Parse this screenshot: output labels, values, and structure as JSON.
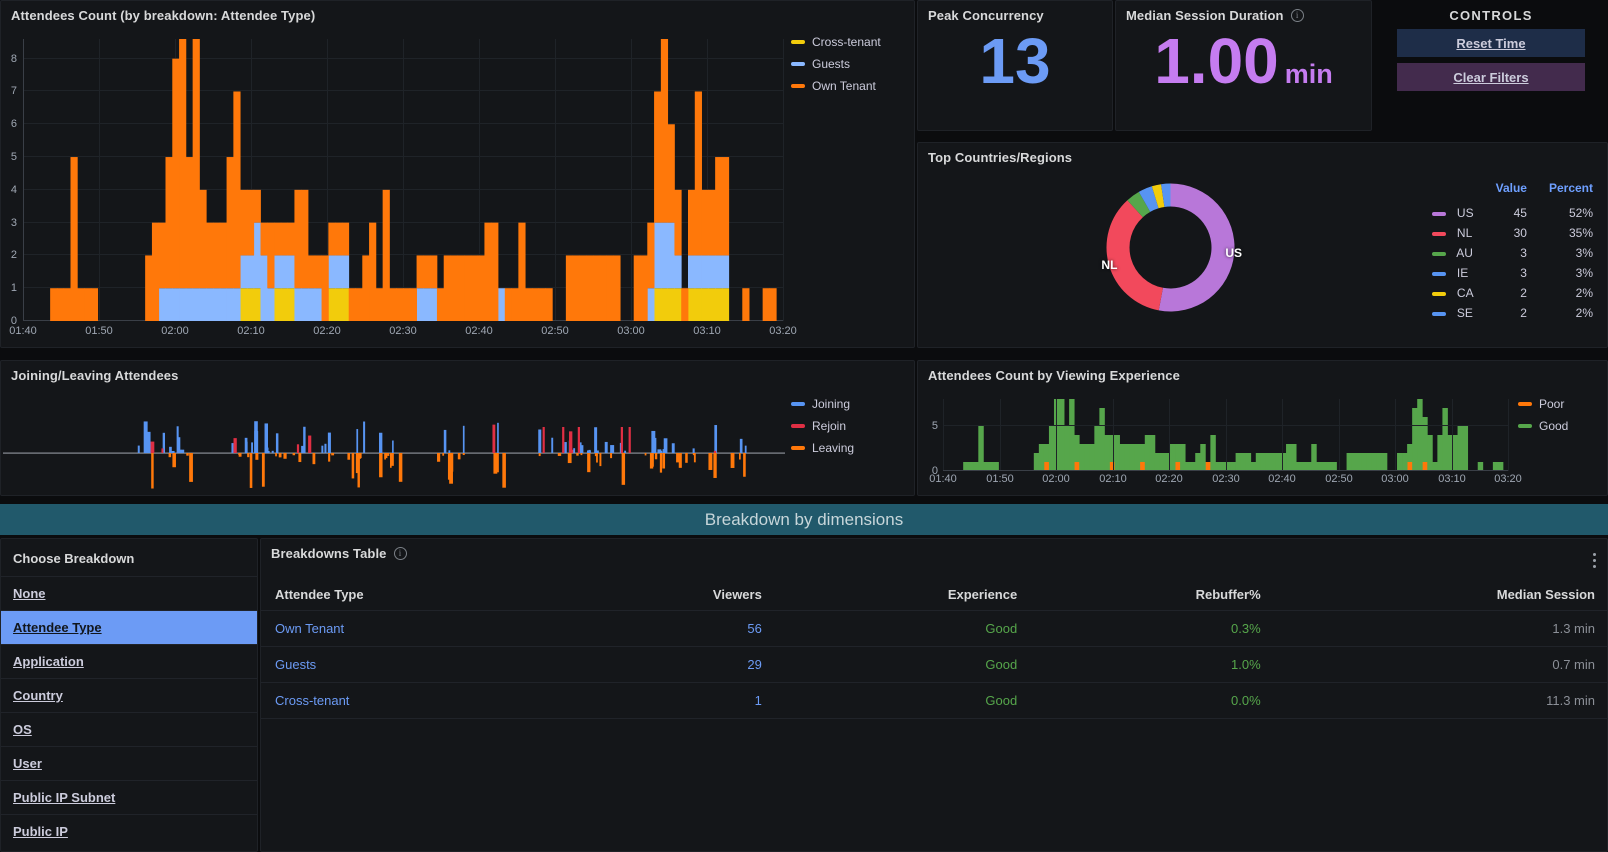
{
  "attendees_panel": {
    "title": "Attendees Count (by breakdown: Attendee Type)",
    "legend": [
      {
        "label": "Cross-tenant",
        "color": "#f2cc0c"
      },
      {
        "label": "Guests",
        "color": "#8ab8ff"
      },
      {
        "label": "Own Tenant",
        "color": "#ff780a"
      }
    ]
  },
  "peak": {
    "title": "Peak Concurrency",
    "value": "13",
    "color": "#6c9bf5"
  },
  "median": {
    "title": "Median Session Duration",
    "value": "1.00",
    "unit": "min",
    "color": "#c57cf0",
    "info_icon": "info-icon"
  },
  "controls": {
    "title": "CONTROLS",
    "reset_label": "Reset Time",
    "clear_label": "Clear Filters"
  },
  "countries": {
    "title": "Top Countries/Regions",
    "col_value": "Value",
    "col_percent": "Percent",
    "donut_labels": [
      "US",
      "NL"
    ],
    "rows": [
      {
        "name": "US",
        "value": "45",
        "percent": "52%",
        "color": "#b877d9"
      },
      {
        "name": "NL",
        "value": "30",
        "percent": "35%",
        "color": "#f2495c"
      },
      {
        "name": "AU",
        "value": "3",
        "percent": "3%",
        "color": "#56a64b"
      },
      {
        "name": "IE",
        "value": "3",
        "percent": "3%",
        "color": "#5794f2"
      },
      {
        "name": "CA",
        "value": "2",
        "percent": "2%",
        "color": "#f2cc0c"
      },
      {
        "name": "SE",
        "value": "2",
        "percent": "2%",
        "color": "#5794f2"
      }
    ]
  },
  "joining": {
    "title": "Joining/Leaving Attendees",
    "legend": [
      {
        "label": "Joining",
        "color": "#5794f2"
      },
      {
        "label": "Rejoin",
        "color": "#e02f44"
      },
      {
        "label": "Leaving",
        "color": "#ff780a"
      }
    ]
  },
  "experience": {
    "title": "Attendees Count by Viewing Experience",
    "legend": [
      {
        "label": "Poor",
        "color": "#ff780a"
      },
      {
        "label": "Good",
        "color": "#56a64b"
      }
    ]
  },
  "banner": {
    "label": "Breakdown by dimensions"
  },
  "breakdown": {
    "header": "Choose Breakdown",
    "items": [
      {
        "label": "None",
        "selected": false
      },
      {
        "label": "Attendee Type",
        "selected": true
      },
      {
        "label": "Application",
        "selected": false
      },
      {
        "label": "Country",
        "selected": false
      },
      {
        "label": "OS",
        "selected": false
      },
      {
        "label": "User",
        "selected": false
      },
      {
        "label": "Public IP Subnet",
        "selected": false
      },
      {
        "label": "Public IP",
        "selected": false
      }
    ]
  },
  "breakdowns_table": {
    "title": "Breakdowns Table",
    "columns": [
      "Attendee Type",
      "Viewers",
      "Experience",
      "Rebuffer%",
      "Median Session"
    ],
    "rows": [
      {
        "type": "Own Tenant",
        "viewers": "56",
        "experience": "Good",
        "rebuffer": "0.3%",
        "median": "1.3 min"
      },
      {
        "type": "Guests",
        "viewers": "29",
        "experience": "Good",
        "rebuffer": "1.0%",
        "median": "0.7 min"
      },
      {
        "type": "Cross-tenant",
        "viewers": "1",
        "experience": "Good",
        "rebuffer": "0.0%",
        "median": "11.3 min"
      }
    ]
  },
  "chart_data": [
    {
      "type": "area",
      "id": "attendees-count",
      "title": "Attendees Count (by breakdown: Attendee Type)",
      "xlabel": "",
      "ylabel": "",
      "ylim": [
        0,
        8.6
      ],
      "yticks": [
        0,
        1,
        2,
        3,
        4,
        5,
        6,
        7,
        8
      ],
      "xticks": [
        "01:40",
        "01:50",
        "02:00",
        "02:10",
        "02:20",
        "02:30",
        "02:40",
        "02:50",
        "03:00",
        "03:10",
        "03:20"
      ],
      "grid": true,
      "legend_position": "right",
      "stacked": true,
      "series": [
        {
          "name": "Cross-tenant",
          "color": "#f2cc0c",
          "values": [
            0,
            0,
            0,
            0,
            0,
            0,
            0,
            0,
            0,
            0,
            0,
            0,
            0,
            0,
            0,
            0,
            0,
            0,
            0,
            0,
            0,
            0,
            0,
            0,
            0,
            0,
            0,
            0,
            0,
            0,
            0,
            0,
            1,
            1,
            1,
            0,
            0,
            1,
            1,
            1,
            0,
            0,
            0,
            0,
            0,
            1,
            1,
            1,
            0,
            0,
            0,
            0,
            0,
            0,
            0,
            0,
            0,
            0,
            0,
            0,
            0,
            0,
            0,
            0,
            0,
            0,
            0,
            0,
            0,
            0,
            0,
            0,
            0,
            0,
            0,
            0,
            0,
            0,
            0,
            0,
            0,
            0,
            0,
            0,
            0,
            0,
            0,
            0,
            0,
            0,
            0,
            0,
            0,
            1,
            1,
            1,
            1,
            0,
            1,
            1,
            1,
            1,
            1,
            1,
            0,
            0,
            0,
            0,
            0,
            0,
            0,
            0
          ]
        },
        {
          "name": "Guests",
          "color": "#8ab8ff",
          "values": [
            0,
            0,
            0,
            0,
            0,
            0,
            0,
            0,
            0,
            0,
            0,
            0,
            0,
            0,
            0,
            0,
            0,
            0,
            0,
            0,
            1,
            1,
            1,
            1,
            1,
            1,
            1,
            1,
            1,
            1,
            1,
            1,
            1,
            1,
            2,
            2,
            1,
            1,
            1,
            1,
            1,
            1,
            1,
            1,
            0,
            1,
            1,
            1,
            0,
            0,
            0,
            0,
            0,
            0,
            0,
            0,
            0,
            0,
            1,
            1,
            1,
            0,
            0,
            0,
            0,
            0,
            0,
            0,
            0,
            0,
            1,
            0,
            0,
            0,
            0,
            0,
            0,
            0,
            0,
            0,
            0,
            0,
            0,
            0,
            0,
            0,
            0,
            0,
            0,
            0,
            0,
            0,
            1,
            2,
            2,
            2,
            1,
            0,
            1,
            1,
            1,
            1,
            1,
            1,
            0,
            0,
            0,
            0,
            0,
            0,
            0,
            0
          ]
        },
        {
          "name": "Own Tenant",
          "color": "#ff780a",
          "values": [
            0,
            0,
            0,
            0,
            1,
            1,
            1,
            5,
            1,
            1,
            1,
            0,
            0,
            0,
            0,
            0,
            0,
            0,
            2,
            3,
            2,
            4,
            7,
            8,
            4,
            8,
            3,
            2,
            2,
            2,
            4,
            6,
            2,
            2,
            1,
            1,
            2,
            1,
            1,
            1,
            3,
            3,
            1,
            1,
            2,
            1,
            1,
            1,
            1,
            1,
            2,
            3,
            1,
            4,
            1,
            1,
            1,
            1,
            1,
            1,
            1,
            1,
            2,
            2,
            2,
            2,
            2,
            2,
            3,
            3,
            0,
            1,
            1,
            3,
            1,
            1,
            1,
            1,
            0,
            0,
            2,
            2,
            2,
            2,
            2,
            2,
            2,
            2,
            0,
            0,
            2,
            2,
            2,
            4,
            6,
            3,
            2,
            1,
            2,
            5,
            2,
            2,
            3,
            3,
            0,
            0,
            1,
            0,
            0,
            1,
            1,
            0
          ]
        }
      ]
    },
    {
      "type": "pie",
      "id": "top-countries",
      "title": "Top Countries/Regions",
      "labels": [
        "US",
        "NL",
        "AU",
        "IE",
        "CA",
        "SE"
      ],
      "values": [
        45,
        30,
        3,
        3,
        2,
        2
      ],
      "percents": [
        "52%",
        "35%",
        "3%",
        "3%",
        "2%",
        "2%"
      ],
      "colors": [
        "#b877d9",
        "#f2495c",
        "#56a64b",
        "#5794f2",
        "#f2cc0c",
        "#5794f2"
      ],
      "legend_position": "right"
    },
    {
      "type": "bar",
      "id": "joining-leaving",
      "title": "Joining/Leaving Attendees",
      "ylim": [
        -4,
        4
      ],
      "grid": false,
      "legend_position": "right",
      "series": [
        {
          "name": "Joining",
          "color": "#5794f2",
          "direction": "up"
        },
        {
          "name": "Rejoin",
          "color": "#e02f44",
          "direction": "up"
        },
        {
          "name": "Leaving",
          "color": "#ff780a",
          "direction": "down"
        }
      ]
    },
    {
      "type": "area",
      "id": "viewing-experience",
      "title": "Attendees Count by Viewing Experience",
      "ylim": [
        0,
        8
      ],
      "yticks": [
        0,
        5
      ],
      "xticks": [
        "01:40",
        "01:50",
        "02:00",
        "02:10",
        "02:20",
        "02:30",
        "02:40",
        "02:50",
        "03:00",
        "03:10",
        "03:20"
      ],
      "grid": true,
      "legend_position": "right",
      "stacked": true,
      "series": [
        {
          "name": "Poor",
          "color": "#ff780a"
        },
        {
          "name": "Good",
          "color": "#56a64b"
        }
      ]
    }
  ]
}
